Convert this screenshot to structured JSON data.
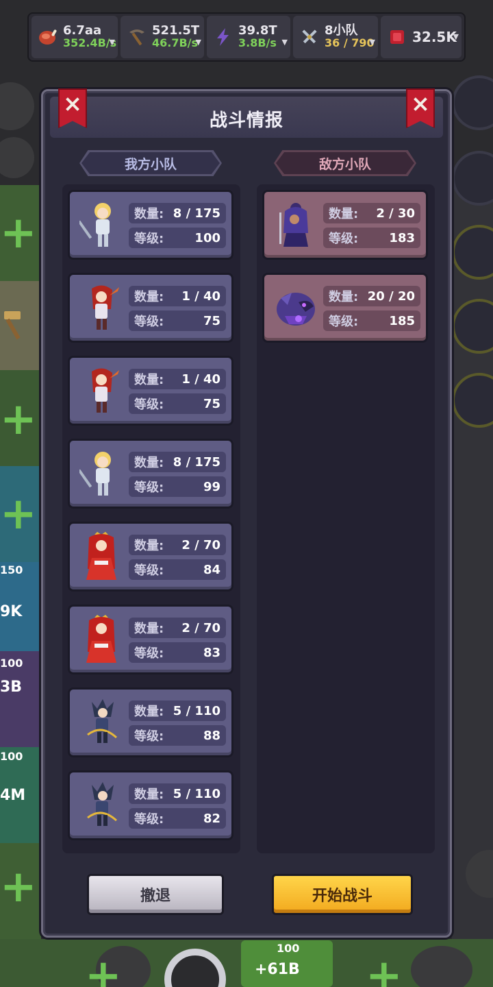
{
  "resources": [
    {
      "value": "6.7aa",
      "rate": "352.4B/s",
      "icon": "meat-icon",
      "rate_color": "green"
    },
    {
      "value": "521.5T",
      "rate": "46.7B/s",
      "icon": "pickaxe-icon",
      "rate_color": "green"
    },
    {
      "value": "39.8T",
      "rate": "3.8B/s",
      "icon": "lightning-icon",
      "rate_color": "green"
    },
    {
      "value": "8小队",
      "rate": "36 / 790",
      "icon": "crossed-swords-icon",
      "rate_color": "gold"
    },
    {
      "value": "32.5K",
      "rate": "",
      "icon": "ruby-icon",
      "rate_color": ""
    }
  ],
  "modal": {
    "title": "战斗情报",
    "ally_label": "我方小队",
    "enemy_label": "敌方小队",
    "stat_count_label": "数量:",
    "stat_level_label": "等级:",
    "retreat_label": "撤退",
    "fight_label": "开始战斗"
  },
  "ally_units": [
    {
      "portrait": "blonde-knight-portrait",
      "count": "8 / 175",
      "level": "100"
    },
    {
      "portrait": "red-hair-warrior-portrait",
      "count": "1 / 40",
      "level": "75"
    },
    {
      "portrait": "red-hair-warrior-portrait",
      "count": "1 / 40",
      "level": "75"
    },
    {
      "portrait": "blonde-knight-portrait",
      "count": "8 / 175",
      "level": "99"
    },
    {
      "portrait": "red-princess-portrait",
      "count": "2 / 70",
      "level": "84"
    },
    {
      "portrait": "red-princess-portrait",
      "count": "2 / 70",
      "level": "83"
    },
    {
      "portrait": "dark-archer-portrait",
      "count": "5 / 110",
      "level": "88"
    },
    {
      "portrait": "dark-archer-portrait",
      "count": "5 / 110",
      "level": "82"
    }
  ],
  "enemy_units": [
    {
      "portrait": "purple-mage-portrait",
      "count": "2 / 30",
      "level": "183"
    },
    {
      "portrait": "purple-beast-portrait",
      "count": "20 / 20",
      "level": "185"
    }
  ],
  "background": {
    "left_tile_labels": [
      "150",
      "9K",
      "100",
      "3B",
      "100",
      "4M"
    ],
    "bottom_badge": {
      "top": "100",
      "label": "+61B"
    }
  },
  "colors": {
    "ally_card": "#5f5c84",
    "enemy_card": "#8b6475",
    "fight_button": "#f5b428",
    "green_rate": "#7fd15a",
    "gold_rate": "#e6c45a"
  }
}
